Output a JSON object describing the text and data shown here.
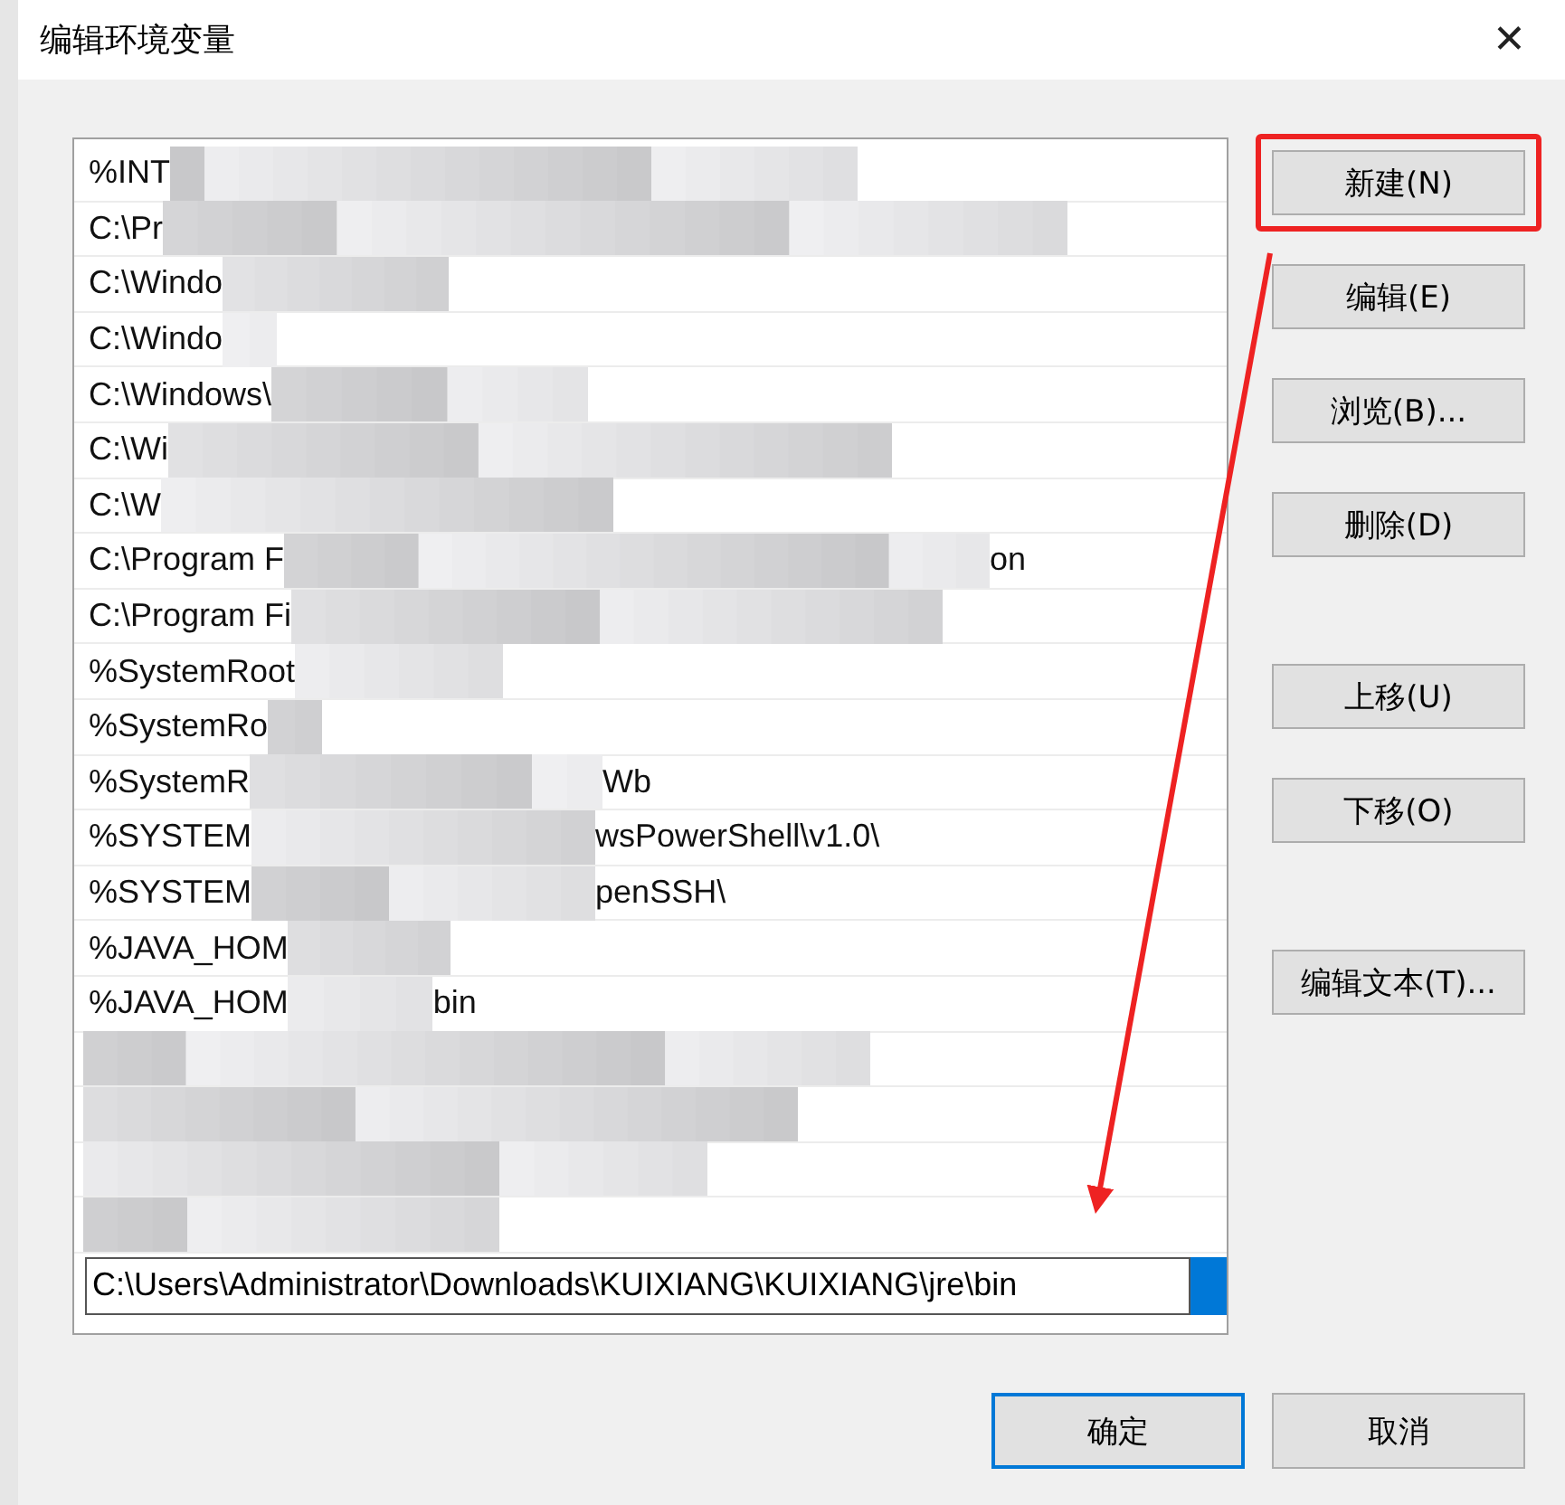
{
  "window": {
    "title": "编辑环境变量",
    "close": "✕"
  },
  "paths": [
    {
      "kind": "text",
      "prefix": "%INT"
    },
    {
      "kind": "text",
      "prefix": "C:\\Pr"
    },
    {
      "kind": "text",
      "prefix": "C:\\Windo"
    },
    {
      "kind": "text",
      "prefix": "C:\\Windo"
    },
    {
      "kind": "text",
      "prefix": "C:\\Windows\\"
    },
    {
      "kind": "text",
      "prefix": "C:\\Wi"
    },
    {
      "kind": "text",
      "prefix": "C:\\W"
    },
    {
      "kind": "text",
      "prefix": "C:\\Program F",
      "suffix": "on"
    },
    {
      "kind": "text",
      "prefix": "C:\\Program Fi"
    },
    {
      "kind": "text",
      "prefix": "%SystemRoot"
    },
    {
      "kind": "text",
      "prefix": "%SystemRo"
    },
    {
      "kind": "text",
      "prefix": "%SystemR",
      "suffix": "Wb"
    },
    {
      "kind": "text",
      "prefix": "%SYSTEM",
      "suffix": "wsPowerShell\\v1.0\\"
    },
    {
      "kind": "text",
      "prefix": "%SYSTEM",
      "suffix": "penSSH\\"
    },
    {
      "kind": "text",
      "prefix": "%JAVA_HOM"
    },
    {
      "kind": "text",
      "prefix": "%JAVA_HOM",
      "suffix": "bin"
    },
    {
      "kind": "redacted"
    },
    {
      "kind": "redacted"
    },
    {
      "kind": "redacted"
    },
    {
      "kind": "redacted"
    }
  ],
  "editing": {
    "value": "C:\\Users\\Administrator\\Downloads\\KUIXIANG\\KUIXIANG\\jre\\bin"
  },
  "side_buttons": [
    {
      "label": "新建(N)",
      "highlighted": true
    },
    {
      "label": "编辑(E)",
      "highlighted": false
    },
    {
      "label": "浏览(B)...",
      "highlighted": false
    },
    {
      "label": "删除(D)",
      "highlighted": false
    },
    {
      "label": "上移(U)",
      "highlighted": false
    },
    {
      "label": "下移(O)",
      "highlighted": false
    },
    {
      "label": "编辑文本(T)...",
      "highlighted": false
    }
  ],
  "footer_buttons": [
    {
      "label": "确定",
      "default": true
    },
    {
      "label": "取消",
      "default": false
    }
  ]
}
